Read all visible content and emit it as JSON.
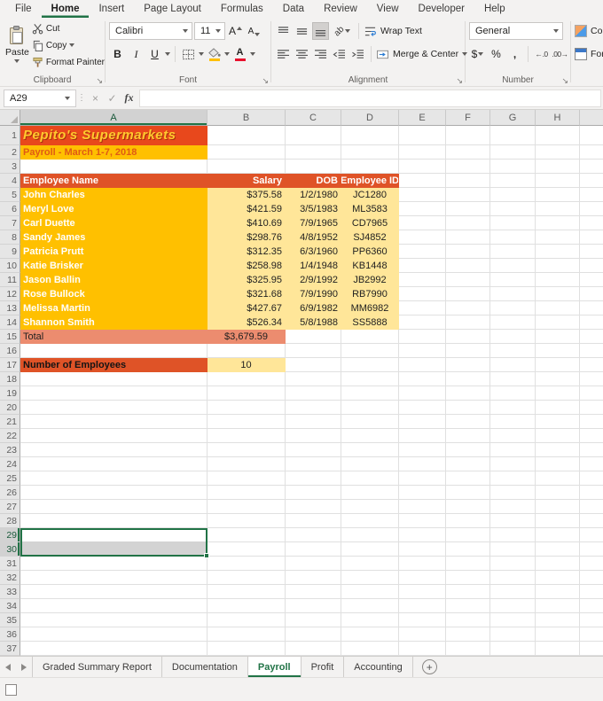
{
  "colors": {
    "green": "#217346",
    "title_bg": "#E8481C",
    "title_text": "#FFC92E",
    "subtitle_bg": "#FFC000",
    "subtitle_text": "#E05A14",
    "head_bg": "#DF5327",
    "head_text": "#FFFFFF",
    "name_bg": "#FFC000",
    "name_text": "#FFFFFF",
    "data_bg": "#FFE699",
    "data_text": "#1F1F1F",
    "total_bg": "#EC8C6F",
    "count_bg": "#DF5327",
    "sel_fill": "#D3D3D3",
    "font_color_bar": "#E8112D",
    "fill_color_bar": "#FFC000"
  },
  "ribbon": {
    "tabs": [
      "File",
      "Home",
      "Insert",
      "Page Layout",
      "Formulas",
      "Data",
      "Review",
      "View",
      "Developer",
      "Help"
    ],
    "active_tab": "Home",
    "clipboard": {
      "label": "Clipboard",
      "paste": "Paste",
      "cut": "Cut",
      "copy": "Copy",
      "format_painter": "Format Painter"
    },
    "font": {
      "label": "Font",
      "family": "Calibri",
      "size": "11",
      "bold": "B",
      "italic": "I",
      "underline": "U",
      "grow": "A",
      "shrink": "A",
      "color_letter": "A"
    },
    "alignment": {
      "label": "Alignment",
      "wrap_text": "Wrap Text",
      "merge_center": "Merge & Center",
      "orientation": "ab"
    },
    "number": {
      "label": "Number",
      "format": "General",
      "currency": "$",
      "percent": "%",
      "comma": ",",
      "inc_decimal": "←.0",
      "dec_decimal": ".00→"
    },
    "styles": {
      "truncated_line1": "Co",
      "truncated_line2": "For"
    }
  },
  "formula_bar": {
    "name_box": "A29",
    "separator": "⋮",
    "cancel": "×",
    "enter": "✓",
    "fx": "fx",
    "value": ""
  },
  "grid": {
    "columns": [
      "A",
      "B",
      "C",
      "D",
      "E",
      "F",
      "G",
      "H"
    ],
    "row_count": 37,
    "active_cell": "A29",
    "selection": "A29:A30"
  },
  "sheet": {
    "title": "Pepito's Supermarkets",
    "subtitle": "Payroll - March 1-7, 2018",
    "table": {
      "headers": [
        "Employee Name",
        "Salary",
        "DOB",
        "Employee ID"
      ],
      "employees": [
        {
          "name": "John Charles",
          "salary": "$375.58",
          "dob": "1/2/1980",
          "id": "JC1280"
        },
        {
          "name": "Meryl Love",
          "salary": "$421.59",
          "dob": "3/5/1983",
          "id": "ML3583"
        },
        {
          "name": "Carl Duette",
          "salary": "$410.69",
          "dob": "7/9/1965",
          "id": "CD7965"
        },
        {
          "name": "Sandy James",
          "salary": "$298.76",
          "dob": "4/8/1952",
          "id": "SJ4852"
        },
        {
          "name": "Patricia Prutt",
          "salary": "$312.35",
          "dob": "6/3/1960",
          "id": "PP6360"
        },
        {
          "name": "Katie Brisker",
          "salary": "$258.98",
          "dob": "1/4/1948",
          "id": "KB1448"
        },
        {
          "name": "Jason Ballin",
          "salary": "$325.95",
          "dob": "2/9/1992",
          "id": "JB2992"
        },
        {
          "name": "Rose Bullock",
          "salary": "$321.68",
          "dob": "7/9/1990",
          "id": "RB7990"
        },
        {
          "name": "Melissa Martin",
          "salary": "$427.67",
          "dob": "6/9/1982",
          "id": "MM6982"
        },
        {
          "name": "Shannon Smith",
          "salary": "$526.34",
          "dob": "5/8/1988",
          "id": "SS5888"
        }
      ],
      "total_label": "Total",
      "total_value": "$3,679.59",
      "count_label": "Number of Employees",
      "count_value": "10"
    }
  },
  "sheet_tabs": {
    "items": [
      "Graded Summary Report",
      "Documentation",
      "Payroll",
      "Profit",
      "Accounting"
    ],
    "active": "Payroll",
    "add_label": "+"
  }
}
